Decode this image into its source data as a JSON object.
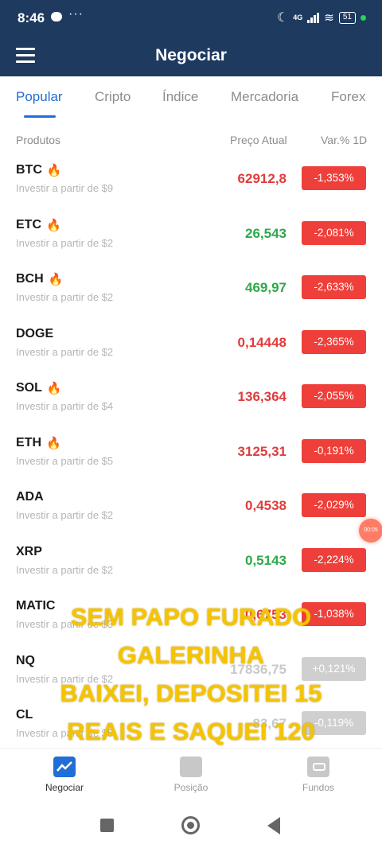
{
  "status": {
    "time": "8:46",
    "dots": "···",
    "network": "4G",
    "battery": "51"
  },
  "appbar": {
    "title": "Negociar"
  },
  "tabs": [
    "Popular",
    "Cripto",
    "Índice",
    "Mercadoria",
    "Forex"
  ],
  "columns": {
    "product": "Produtos",
    "price": "Preço Atual",
    "change": "Var.% 1D"
  },
  "rows": [
    {
      "symbol": "BTC",
      "fire": true,
      "sub": "Investir a partir de $9",
      "price": "62912,8",
      "price_color": "red",
      "change": "-1,353%",
      "badge": "red"
    },
    {
      "symbol": "ETC",
      "fire": true,
      "sub": "Investir a partir de $2",
      "price": "26,543",
      "price_color": "green",
      "change": "-2,081%",
      "badge": "red"
    },
    {
      "symbol": "BCH",
      "fire": true,
      "sub": "Investir a partir de $2",
      "price": "469,97",
      "price_color": "green",
      "change": "-2,633%",
      "badge": "red"
    },
    {
      "symbol": "DOGE",
      "fire": false,
      "sub": "Investir a partir de $2",
      "price": "0,14448",
      "price_color": "red",
      "change": "-2,365%",
      "badge": "red"
    },
    {
      "symbol": "SOL",
      "fire": true,
      "sub": "Investir a partir de $4",
      "price": "136,364",
      "price_color": "red",
      "change": "-2,055%",
      "badge": "red"
    },
    {
      "symbol": "ETH",
      "fire": true,
      "sub": "Investir a partir de $5",
      "price": "3125,31",
      "price_color": "red",
      "change": "-0,191%",
      "badge": "red"
    },
    {
      "symbol": "ADA",
      "fire": false,
      "sub": "Investir a partir de $2",
      "price": "0,4538",
      "price_color": "red",
      "change": "-2,029%",
      "badge": "red"
    },
    {
      "symbol": "XRP",
      "fire": false,
      "sub": "Investir a partir de $2",
      "price": "0,5143",
      "price_color": "green",
      "change": "-2,224%",
      "badge": "red"
    },
    {
      "symbol": "MATIC",
      "fire": false,
      "sub": "Investir a partir de $3",
      "price": "0,6753",
      "price_color": "red",
      "change": "-1,038%",
      "badge": "red"
    },
    {
      "symbol": "NQ",
      "fire": false,
      "sub": "Investir a partir de $2",
      "price": "17836,75",
      "price_color": "gray",
      "change": "+0,121%",
      "badge": "gray"
    },
    {
      "symbol": "CL",
      "fire": false,
      "sub": "Investir a partir de $5",
      "price": "83,67",
      "price_color": "gray",
      "change": "-0,119%",
      "badge": "gray"
    }
  ],
  "float_button": "00:05",
  "overlay_lines": [
    "SEM PAPO FURADO",
    "GALERINHA",
    "BAIXEI, DEPOSITEI 15",
    "REAIS E SAQUEI 120",
    "REAIS"
  ],
  "bottom_nav": [
    {
      "label": "Negociar",
      "icon": "chart-icon",
      "active": true
    },
    {
      "label": "Posição",
      "icon": "position-icon",
      "active": false
    },
    {
      "label": "Fundos",
      "icon": "wallet-icon",
      "active": false
    }
  ],
  "colors": {
    "header": "#1e3a5f",
    "accent": "#1f6fd6",
    "down": "#ef3f3a",
    "up": "#2ea84b",
    "overlay": "#f5c400"
  }
}
